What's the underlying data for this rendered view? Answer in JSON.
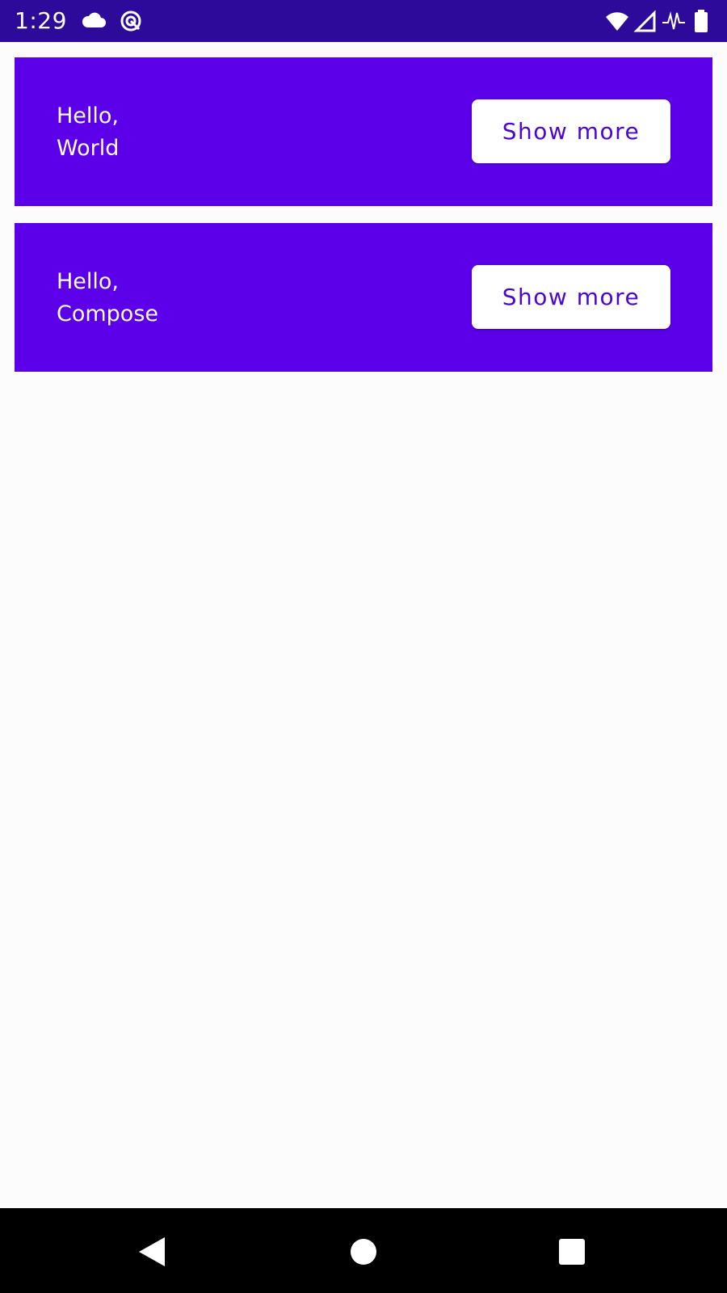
{
  "status_bar": {
    "time": "1:29",
    "background": "#2e0a9b",
    "left_icons": [
      "cloud-icon",
      "data-saver-icon"
    ],
    "right_icons": [
      "wifi-icon",
      "cellular-signal-icon",
      "activity-icon",
      "battery-icon"
    ]
  },
  "cards": [
    {
      "line1": "Hello,",
      "line2": "World",
      "button_label": "Show more"
    },
    {
      "line1": "Hello,",
      "line2": "Compose",
      "button_label": "Show more"
    }
  ],
  "colors": {
    "card_background": "#5b00e8",
    "button_text": "#4b05d6",
    "page_background": "#fdfcfd",
    "nav_background": "#000000"
  },
  "nav_bar": {
    "buttons": [
      "back-icon",
      "home-icon",
      "recents-icon"
    ]
  }
}
